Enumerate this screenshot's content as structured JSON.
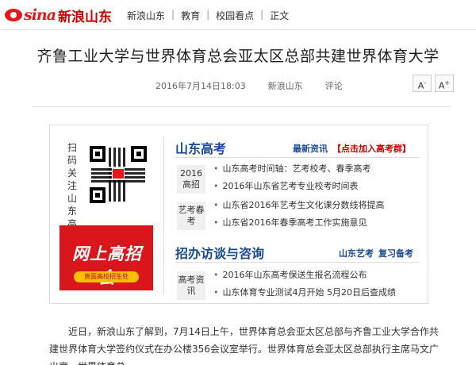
{
  "header": {
    "logo_sina": "sina",
    "logo_cn": "新浪山东",
    "breadcrumb": [
      "新浪山东",
      "教育",
      "校园看点",
      "正文"
    ],
    "breadcrumb_sep": "|"
  },
  "article": {
    "title": "齐鲁工业大学与世界体育总会亚太区总部共建世界体育大学",
    "date": "2016年7月14日18:03",
    "source": "新浪山东",
    "comment": "评论",
    "font_decrease": "A",
    "font_increase": "A",
    "font_decrease_sup": "-",
    "font_increase_sup": "+",
    "paragraph": "近日，新浪山东了解到，7月14日上午，世界体育总会亚太区总部与齐鲁工业大学合作共建世界体育大学签约仪式在办公楼356会议室举行。世界体育总会亚太区总部执行主席马文广出席，世界体育总"
  },
  "promo": {
    "scan_text": "扫码关注山东高考",
    "banner_text": "网上高招会",
    "banner_sub": "直面高校招生处",
    "section1": {
      "title": "山东高考",
      "link1": "最新资讯",
      "link2": "【点击加入高考群】",
      "groups": [
        {
          "tag": "2016高招",
          "items": [
            "山东高考时间轴：艺考校考、春季高考",
            "2016年山东省艺考专业校考时间表"
          ]
        },
        {
          "tag": "艺考春考",
          "items": [
            "山东省2016年艺考生文化课分数线将提高",
            "山东省2016年春季高考工作实施意见"
          ]
        }
      ]
    },
    "section2": {
      "title": "招办访谈与咨询",
      "link1": "山东艺考",
      "link2": "复习备考",
      "groups": [
        {
          "tag": "高考资讯",
          "items": [
            "2016年山东高考保送生报名流程公布",
            "山东体育专业测试4月开始 5月20日后查成绩"
          ]
        }
      ]
    }
  },
  "colors": {
    "brand_red": "#e7161b",
    "link_blue": "#1a4a92",
    "accent_red": "#c00000"
  }
}
